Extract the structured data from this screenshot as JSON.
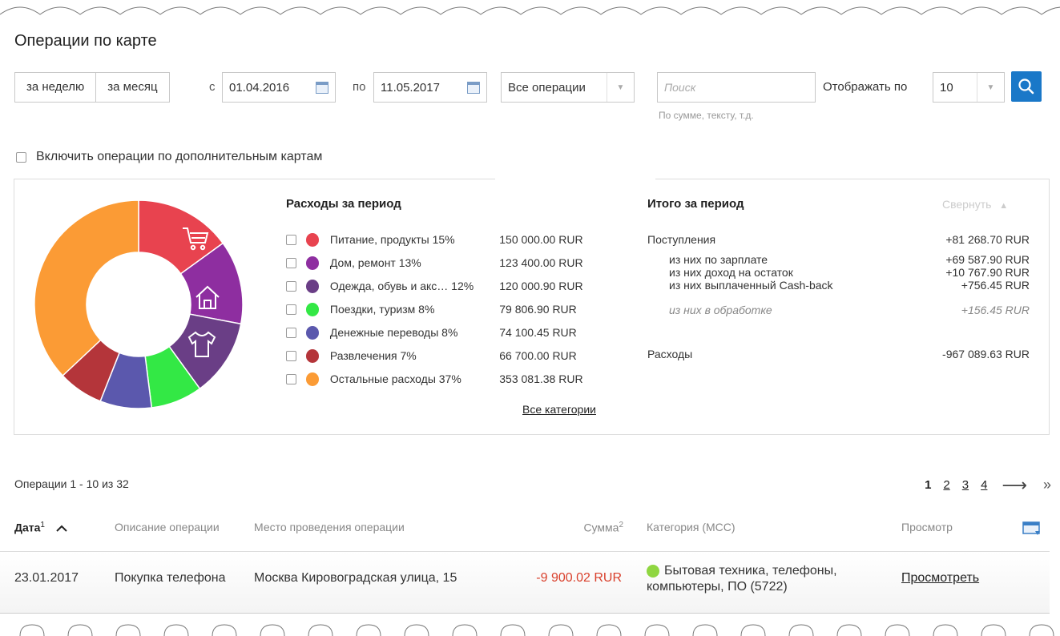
{
  "title": "Операции по карте",
  "filters": {
    "week_label": "за неделю",
    "month_label": "за месяц",
    "from_label": "с",
    "from_date": "01.04.2016",
    "to_label": "по",
    "to_date": "11.05.2017",
    "ops_type": "Все операции",
    "search_placeholder": "Поиск",
    "search_hint": "По сумме, тексту, т.д.",
    "per_page_label": "Отображать по",
    "per_page_value": "10",
    "include_extra_cards": "Включить операции по дополнительным картам"
  },
  "expenses": {
    "title": "Расходы за период",
    "all_categories": "Все категории",
    "categories": [
      {
        "name": "Питание, продукты 15%",
        "amount": "150 000.00 RUR",
        "color": "#e8434f",
        "share": 15
      },
      {
        "name": "Дом, ремонт 13%",
        "amount": "123 400.00 RUR",
        "color": "#8e2ea0",
        "share": 13
      },
      {
        "name": "Одежда, обувь и акс…  12%",
        "amount": "120 000.90 RUR",
        "color": "#6a3e86",
        "share": 12
      },
      {
        "name": "Поездки, туризм 8%",
        "amount": "79 806.90 RUR",
        "color": "#33e845",
        "share": 8
      },
      {
        "name": "Денежные переводы 8%",
        "amount": "74 100.45 RUR",
        "color": "#5b58ad",
        "share": 8
      },
      {
        "name": "Развлечения 7%",
        "amount": "66 700.00 RUR",
        "color": "#b4353a",
        "share": 7
      },
      {
        "name": "Остальные расходы 37%",
        "amount": "353 081.38 RUR",
        "color": "#fb9b35",
        "share": 37
      }
    ]
  },
  "totals": {
    "title": "Итого за период",
    "collapse": "Свернуть",
    "income_label": "Поступления",
    "income_value": "+81 268.70 RUR",
    "details": [
      {
        "label": "из них по зарплате",
        "value": "+69 587.90 RUR"
      },
      {
        "label": "из них доход на остаток",
        "value": "+10 767.90 RUR"
      },
      {
        "label": "из них выплаченный Cash-back",
        "value": "+756.45 RUR"
      }
    ],
    "processing_label": "из них в обработке",
    "processing_value": "+156.45 RUR",
    "expense_label": "Расходы",
    "expense_value": "-967 089.63 RUR"
  },
  "list": {
    "range": "Операции 1 - 10 из 32",
    "current_page": "1",
    "pages": [
      "2",
      "3",
      "4"
    ],
    "next": "⟶",
    "last": "»",
    "headers": {
      "date": "Дата",
      "date_sup": "1",
      "description": "Описание операции",
      "place": "Место проведения операции",
      "amount": "Сумма",
      "amount_sup": "2",
      "category": "Категория (МСС)",
      "view": "Просмотр"
    },
    "rows": [
      {
        "date": "23.01.2017",
        "description": "Покупка телефона",
        "place": "Москва Кировоградская улица, 15",
        "amount": "-9 900.02 RUR",
        "category_line1": "Бытовая техника, телефоны,",
        "category_line2": "компьютеры, ПО (5722)",
        "category_color": "#8fd641",
        "view": "Просмотреть"
      }
    ]
  }
}
